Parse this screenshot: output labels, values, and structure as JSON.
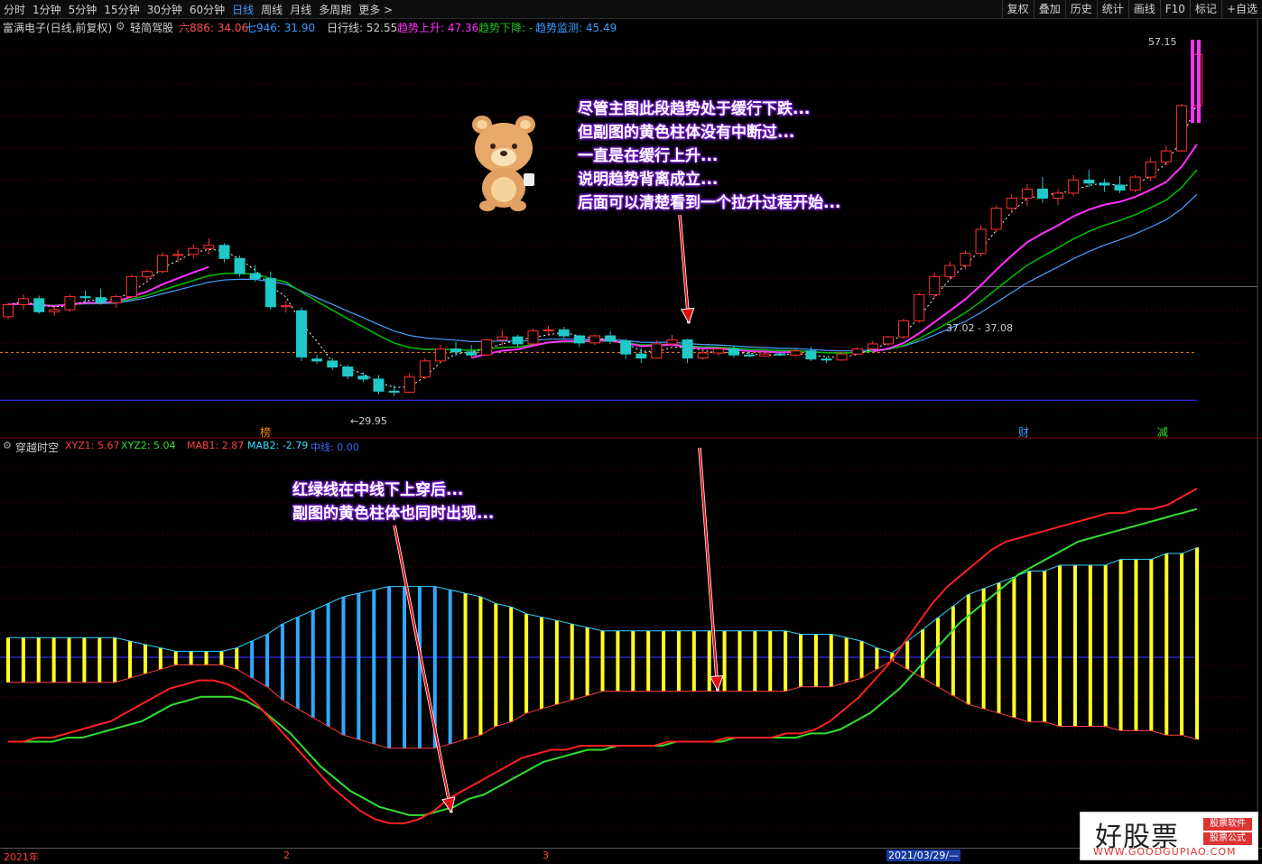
{
  "toolbar": {
    "periods": [
      "分时",
      "1分钟",
      "5分钟",
      "15分钟",
      "30分钟",
      "60分钟",
      "日线",
      "周线",
      "月线",
      "多周期",
      "更多 >"
    ],
    "active_period": "日线",
    "right_buttons": [
      "复权",
      "叠加",
      "历史",
      "统计",
      "画线",
      "F10",
      "标记",
      "+自选"
    ]
  },
  "main_info": {
    "stock": "富满电子(日线,前复权)",
    "indicator": "轻简驾股",
    "six": "六886: 34.06",
    "seven": "七946: 31.90",
    "daily_line": "日行线: 52.55",
    "trend_up": "趋势上升: 47.36",
    "trend_down": "趋势下降: -",
    "trend_monitor": "趋势监测: 45.49"
  },
  "sub_info": {
    "name": "穿越时空",
    "xyz1": "XYZ1: 5.67",
    "xyz2": "XYZ2: 5.04",
    "mab1": "MAB1: 2.87",
    "mab2": "MAB2: -2.79",
    "mid": "中线: 0.00"
  },
  "price_labels": {
    "high": "57.15",
    "low": "29.95",
    "range": "37.02 - 37.08"
  },
  "markers": {
    "bang": "榜",
    "cai": "财",
    "jian": "减"
  },
  "annotations": {
    "main": [
      "尽管主图此段趋势处于缓行下跌...",
      "但副图的黄色柱体没有中断过...",
      "一直是在缓行上升...",
      "说明趋势背离成立...",
      "后面可以清楚看到一个拉升过程开始..."
    ],
    "sub": [
      "红绿线在中线下上穿后...",
      "副图的黄色柱体也同时出现..."
    ]
  },
  "timeline": {
    "year": "2021年",
    "m2": "2",
    "m3": "3",
    "cursor_date": "2021/03/29/—"
  },
  "logo": {
    "main": "好股票",
    "badge1": "股票软件",
    "badge2": "股票公式",
    "url": "WWW.GOODGUPIAO.COM"
  },
  "colors": {
    "up": "#ff3232",
    "down": "#20c8c8",
    "ma_pink": "#ff30ff",
    "ma_green": "#00c000",
    "ma_blue": "#4aa0ff",
    "bar_yellow": "#ffff20",
    "bar_blue": "#30a8ff",
    "annot_glow": "#7a1fd6"
  },
  "chart_data": [
    {
      "type": "candlestick",
      "title": "富满电子(日线,前复权)",
      "candles": [
        [
          30.8,
          32.2,
          30.6,
          32.0
        ],
        [
          32.0,
          33.0,
          31.5,
          32.6
        ],
        [
          32.6,
          32.9,
          31.1,
          31.3
        ],
        [
          31.3,
          31.9,
          30.9,
          31.5
        ],
        [
          31.5,
          33.0,
          31.3,
          32.8
        ],
        [
          32.8,
          33.4,
          32.2,
          32.7
        ],
        [
          32.7,
          33.6,
          32.0,
          32.2
        ],
        [
          32.2,
          33.0,
          31.7,
          32.8
        ],
        [
          32.8,
          35.0,
          32.6,
          34.8
        ],
        [
          34.8,
          35.5,
          34.2,
          35.3
        ],
        [
          35.3,
          37.2,
          35.1,
          36.9
        ],
        [
          36.9,
          37.5,
          36.2,
          37.0
        ],
        [
          37.0,
          38.0,
          36.6,
          37.6
        ],
        [
          37.6,
          38.6,
          37.0,
          37.9
        ],
        [
          37.9,
          38.1,
          36.2,
          36.6
        ],
        [
          36.6,
          36.9,
          34.8,
          35.1
        ],
        [
          35.1,
          35.9,
          34.3,
          34.6
        ],
        [
          34.6,
          35.3,
          31.5,
          31.8
        ],
        [
          31.8,
          32.4,
          31.2,
          31.9
        ],
        [
          31.4,
          31.7,
          26.4,
          26.8
        ],
        [
          26.6,
          27.0,
          26.1,
          26.4
        ],
        [
          26.4,
          26.7,
          25.5,
          25.8
        ],
        [
          25.8,
          26.0,
          24.6,
          24.9
        ],
        [
          24.9,
          25.3,
          24.3,
          24.6
        ],
        [
          24.6,
          25.0,
          23.1,
          23.4
        ],
        [
          23.4,
          24.0,
          22.9,
          23.3
        ],
        [
          23.3,
          25.2,
          23.2,
          24.8
        ],
        [
          24.8,
          26.7,
          24.6,
          26.4
        ],
        [
          26.4,
          28.0,
          26.2,
          27.6
        ],
        [
          27.6,
          28.3,
          26.9,
          27.3
        ],
        [
          27.3,
          28.0,
          26.8,
          27.0
        ],
        [
          27.0,
          28.6,
          26.9,
          28.5
        ],
        [
          28.5,
          29.5,
          28.0,
          28.8
        ],
        [
          28.8,
          29.0,
          27.8,
          28.1
        ],
        [
          28.1,
          29.6,
          28.0,
          29.4
        ],
        [
          29.4,
          29.9,
          28.9,
          29.5
        ],
        [
          29.5,
          29.8,
          28.6,
          28.9
        ],
        [
          28.9,
          29.0,
          27.8,
          28.2
        ],
        [
          28.2,
          29.0,
          28.0,
          28.9
        ],
        [
          28.9,
          29.4,
          28.1,
          28.4
        ],
        [
          28.4,
          28.6,
          26.6,
          27.1
        ],
        [
          27.1,
          27.7,
          26.2,
          26.7
        ],
        [
          26.7,
          28.5,
          26.6,
          28.1
        ],
        [
          28.1,
          29.0,
          27.7,
          28.5
        ],
        [
          28.5,
          28.6,
          26.2,
          26.7
        ],
        [
          26.7,
          27.5,
          26.5,
          27.2
        ],
        [
          27.2,
          27.8,
          26.9,
          27.6
        ],
        [
          27.6,
          27.9,
          26.7,
          27.0
        ],
        [
          27.0,
          27.4,
          26.8,
          26.9
        ],
        [
          26.9,
          27.6,
          26.8,
          27.1
        ],
        [
          27.1,
          27.3,
          26.9,
          27.0
        ],
        [
          27.0,
          27.6,
          26.8,
          27.4
        ],
        [
          27.4,
          27.8,
          26.4,
          26.6
        ],
        [
          26.6,
          26.8,
          26.2,
          26.5
        ],
        [
          26.5,
          27.3,
          26.4,
          27.1
        ],
        [
          27.1,
          27.8,
          27.0,
          27.6
        ],
        [
          27.6,
          28.4,
          27.4,
          28.1
        ],
        [
          28.1,
          28.9,
          27.9,
          28.8
        ],
        [
          28.8,
          30.6,
          28.6,
          30.4
        ],
        [
          30.4,
          33.2,
          30.2,
          33.0
        ],
        [
          33.0,
          35.2,
          32.7,
          34.8
        ],
        [
          34.8,
          36.3,
          34.5,
          35.9
        ],
        [
          35.9,
          37.4,
          35.5,
          37.1
        ],
        [
          37.1,
          39.9,
          36.8,
          39.5
        ],
        [
          39.5,
          41.9,
          39.2,
          41.6
        ],
        [
          41.6,
          43.0,
          41.1,
          42.6
        ],
        [
          42.6,
          44.0,
          41.8,
          43.5
        ],
        [
          43.5,
          44.7,
          42.1,
          42.6
        ],
        [
          42.6,
          43.5,
          41.9,
          43.1
        ],
        [
          43.1,
          44.9,
          42.8,
          44.4
        ],
        [
          44.4,
          45.4,
          43.7,
          44.1
        ],
        [
          44.1,
          44.5,
          43.2,
          43.9
        ],
        [
          43.9,
          44.8,
          43.1,
          43.4
        ],
        [
          43.4,
          44.9,
          43.2,
          44.7
        ],
        [
          44.7,
          46.6,
          44.3,
          46.2
        ],
        [
          46.2,
          47.8,
          45.9,
          47.3
        ],
        [
          47.3,
          52.0,
          47.2,
          51.8
        ],
        [
          51.8,
          57.15,
          51.6,
          56.9
        ]
      ]
    },
    {
      "type": "bar",
      "title": "穿越时空",
      "xyz1": [
        -8,
        -8,
        -7,
        -7,
        -6,
        -5,
        -4,
        -3,
        -1,
        1,
        3,
        5,
        6,
        7,
        7,
        6,
        4,
        1,
        -3,
        -7,
        -11,
        -15,
        -19,
        -22,
        -25,
        -27,
        -28,
        -28,
        -27,
        -25,
        -22,
        -20,
        -18,
        -16,
        -14,
        -12,
        -11,
        -10,
        -10,
        -9,
        -9,
        -9,
        -9,
        -9,
        -9,
        -8,
        -8,
        -8,
        -8,
        -7,
        -7,
        -7,
        -7,
        -6,
        -6,
        -5,
        -3,
        0,
        3,
        7,
        11,
        16,
        21,
        26,
        30,
        33,
        36,
        39,
        41,
        42,
        43,
        44,
        45,
        46,
        47,
        48,
        48,
        49,
        49,
        50,
        52,
        54
      ],
      "xyz2": [
        -8,
        -8,
        -8,
        -8,
        -7,
        -7,
        -6,
        -5,
        -4,
        -3,
        -1,
        1,
        2,
        3,
        3,
        3,
        2,
        0,
        -3,
        -6,
        -10,
        -14,
        -17,
        -20,
        -22,
        -24,
        -25,
        -26,
        -26,
        -25,
        -24,
        -22,
        -21,
        -19,
        -17,
        -15,
        -13,
        -12,
        -11,
        -10,
        -10,
        -9,
        -9,
        -9,
        -9,
        -8,
        -8,
        -8,
        -8,
        -7,
        -7,
        -7,
        -7,
        -7,
        -6,
        -6,
        -5,
        -3,
        -1,
        2,
        5,
        9,
        13,
        17,
        21,
        24,
        27,
        30,
        33,
        35,
        37,
        39,
        41,
        42,
        43,
        44,
        45,
        46,
        47,
        48,
        49
      ],
      "bars": [
        -5,
        -5,
        -5,
        -5,
        -5,
        -5,
        -5,
        -5,
        -4,
        -3,
        -2,
        -1,
        -1,
        -1,
        -1,
        -2,
        -4,
        -6,
        -9,
        -11,
        -13,
        -15,
        -17,
        -18,
        -19,
        -20,
        -20,
        -20,
        -20,
        -19,
        -18,
        -17,
        -15,
        -14,
        -12,
        -11,
        -10,
        -9,
        -8,
        -7,
        -7,
        -7,
        -7,
        -7,
        -7,
        -7,
        -7,
        -7,
        -7,
        -7,
        -7,
        -7,
        -6,
        -6,
        -6,
        -5,
        -4,
        -2,
        0,
        2,
        4,
        6,
        8,
        10,
        11,
        12,
        13,
        14,
        14,
        15,
        15,
        15,
        15,
        16,
        16,
        16,
        17,
        17,
        18
      ]
    }
  ]
}
